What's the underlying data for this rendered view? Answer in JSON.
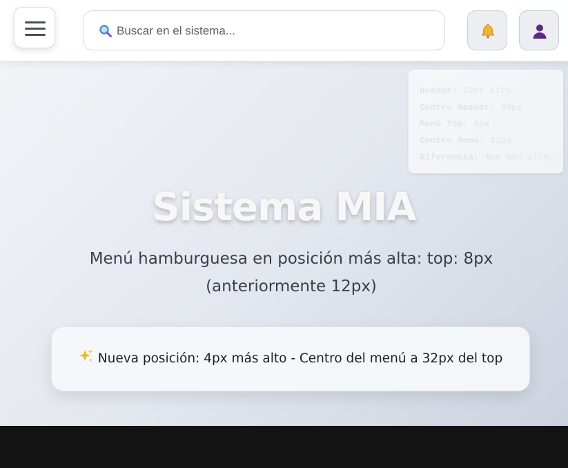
{
  "header": {
    "menu_icon": "hamburger-menu-icon",
    "search": {
      "icon": "magnifier-icon",
      "placeholder": "Buscar en el sistema...",
      "value": ""
    },
    "notifications_icon": "bell-icon",
    "user_icon": "user-icon"
  },
  "info_panel": [
    {
      "key": "Header:",
      "value": "72px alto"
    },
    {
      "key": "Centro Header:",
      "value": "36px"
    },
    {
      "key": "Menú Top:",
      "value": "8px"
    },
    {
      "key": "Centro Menú:",
      "value": "32px"
    },
    {
      "key": "Diferencia:",
      "value": "4px más alto"
    }
  ],
  "hero": {
    "title": "Sistema MIA",
    "subtitle": "Menú hamburguesa en posición más alta: top: 8px (anteriormente 12px)"
  },
  "callout": {
    "icon": "sparkles-icon",
    "text": "Nueva posición: 4px más alto - Centro del menú a 32px del top"
  },
  "colors": {
    "bell": "#f2b233",
    "user": "#5b2a86",
    "footer": "#131313"
  }
}
